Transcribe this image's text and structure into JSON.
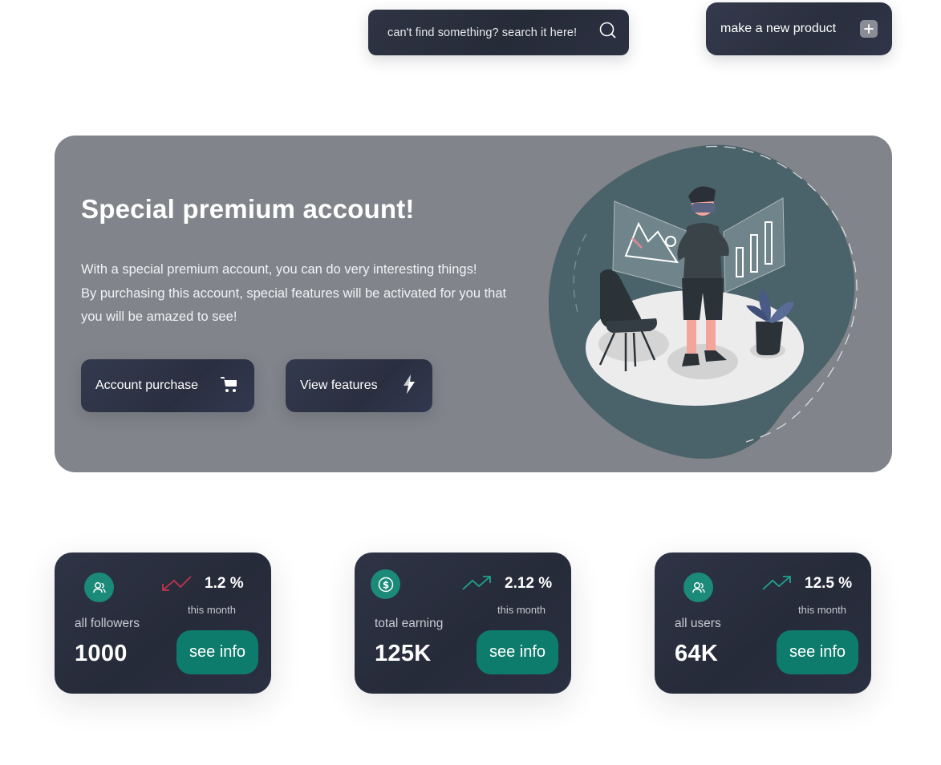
{
  "search": {
    "placeholder": "can't find something? search it here!"
  },
  "header": {
    "new_product_label": "make a new product"
  },
  "hero": {
    "title": "Special premium account!",
    "lines": [
      "With a special premium account, you can do very interesting things!",
      "By purchasing this account, special features will be activated for you that",
      "you will be amazed to see!"
    ],
    "purchase_label": "Account purchase",
    "features_label": "View features"
  },
  "cards": [
    {
      "icon": "users-icon",
      "trend": "down",
      "percent": "1.2 %",
      "period": "this month",
      "label": "all followers",
      "value": "1000",
      "action": "see info"
    },
    {
      "icon": "dollar-icon",
      "trend": "up",
      "percent": "2.12 %",
      "period": "this month",
      "label": "total earning",
      "value": "125K",
      "action": "see info"
    },
    {
      "icon": "users-icon",
      "trend": "up",
      "percent": "12.5 %",
      "period": "this month",
      "label": "all users",
      "value": "64K",
      "action": "see info"
    }
  ],
  "colors": {
    "dark": "#2a2f3f",
    "hero_bg": "#81848a",
    "accent": "#0e7c6c",
    "trend_up": "#1fa38e",
    "trend_down": "#c2334d"
  }
}
